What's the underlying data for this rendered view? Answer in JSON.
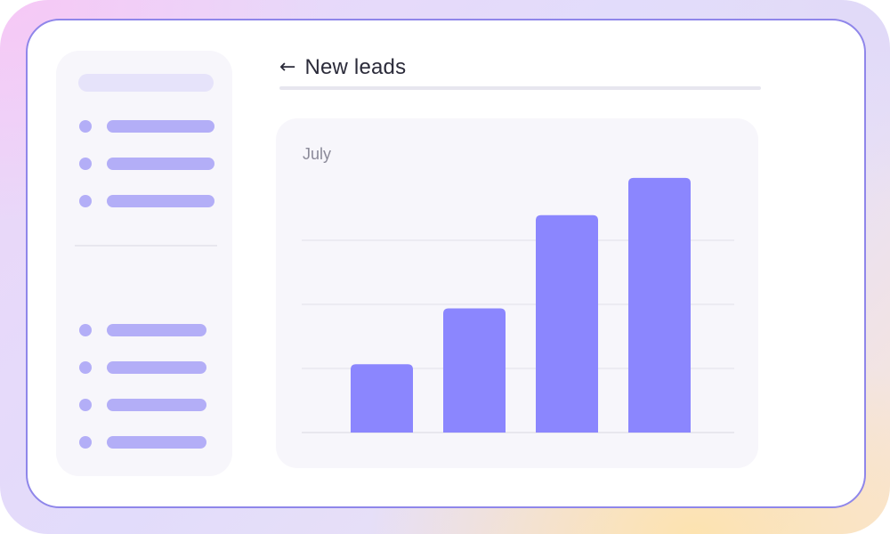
{
  "header": {
    "back_icon": "←",
    "title": "New leads"
  },
  "sidebar": {
    "top_items": 3,
    "bottom_items": 4,
    "accent_color": "#b3aef7"
  },
  "chart_data": {
    "type": "bar",
    "categories": [
      "",
      "",
      "",
      ""
    ],
    "values": [
      1.1,
      2.0,
      3.5,
      4.1
    ],
    "title": "July",
    "xlabel": "",
    "ylabel": "",
    "ylim": [
      0,
      4.4
    ],
    "grid": true,
    "bar_color": "#8b86fe"
  }
}
